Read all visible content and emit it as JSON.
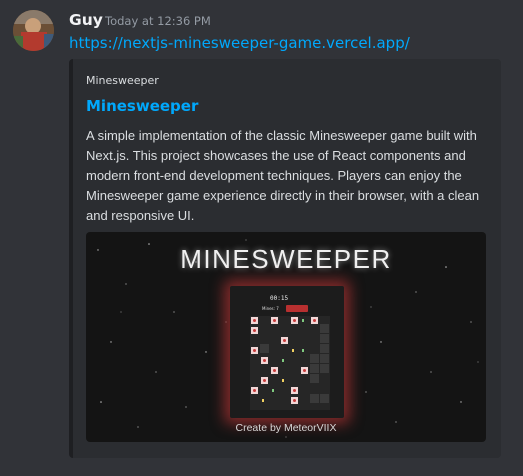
{
  "message": {
    "username": "Guy",
    "timestamp": "Today at 12:36 PM",
    "link_text": "https://nextjs-minesweeper-game.vercel.app/"
  },
  "embed": {
    "provider": "Minesweeper",
    "title": "Minesweeper",
    "description": "A simple implementation of the classic Minesweeper game built with Next.js. This project showcases the use of React components and modern front-end development techniques. Players can enjoy the Minesweeper game experience directly in their browser, with a clean and responsive UI.",
    "image": {
      "title": "MINESWEEPER",
      "credit": "Create by MeteorVIIX",
      "timer": "00:15",
      "mines_label": "Mines: 7",
      "accent_color": "#dc3c3c"
    }
  },
  "colors": {
    "background": "#313338",
    "embed_background": "#2b2d31",
    "link": "#00a8fc",
    "username": "#f2f3f5",
    "timestamp": "#949ba4"
  }
}
